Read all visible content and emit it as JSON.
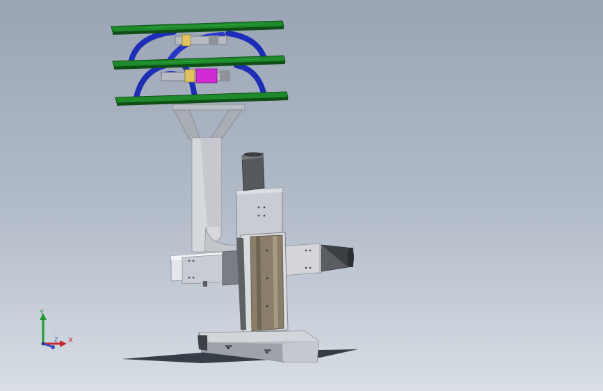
{
  "viewport": {
    "background_top": "#9aa4b4",
    "background_bottom": "#d9dee5"
  },
  "model": {
    "colors": {
      "pcb_green": "#1e8a2c",
      "pcb_edge": "#0f4f16",
      "arc_blue": "#1d2db8",
      "aluminum": "#c9ccd2",
      "aluminum_dark": "#8e929a",
      "motor_dark": "#4a4d52",
      "rail_bronze": "#8a7e6a",
      "magenta_motor": "#d12bd6",
      "shadow": "#1c222b"
    }
  },
  "triad": {
    "y_label": "Y",
    "x_label": "X",
    "z_label": "Z",
    "y_color": "#1e9a34",
    "x_color": "#c42a2a",
    "z_color": "#3b4fc7"
  }
}
